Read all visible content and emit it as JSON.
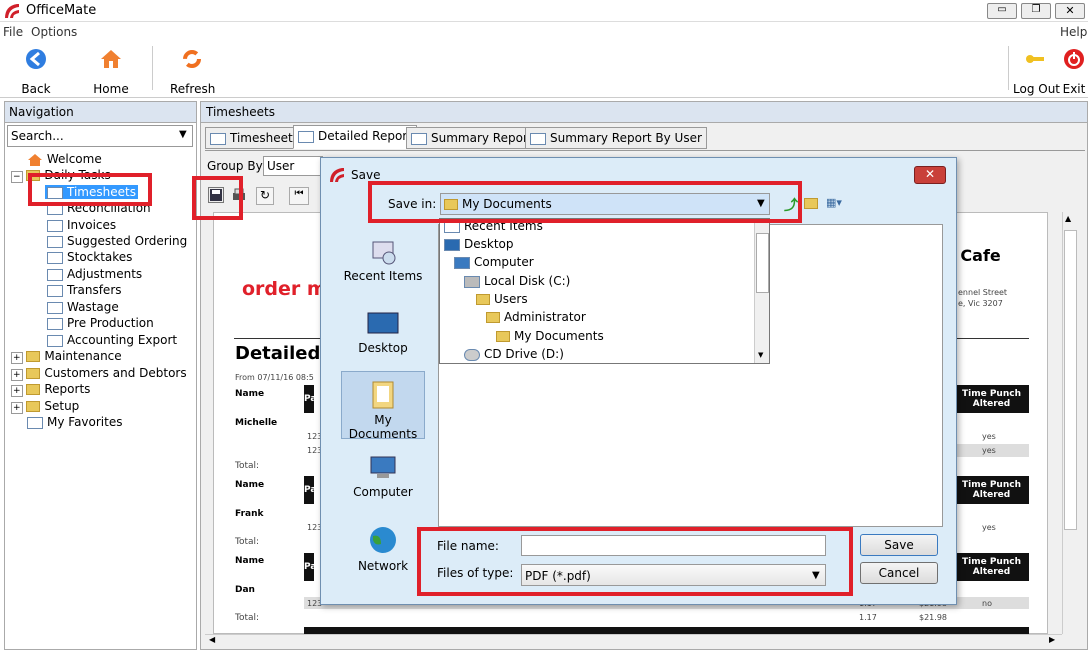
{
  "app": {
    "title": "OfficeMate"
  },
  "menu": {
    "file": "File",
    "options": "Options",
    "help": "Help"
  },
  "toolbar": {
    "back": "Back",
    "home": "Home",
    "refresh": "Refresh",
    "logout": "Log Out",
    "exit": "Exit"
  },
  "navigation": {
    "header": "Navigation",
    "search_value": "Search...",
    "items": {
      "welcome": "Welcome",
      "daily_tasks": "Daily Tasks",
      "timesheets": "Timesheets",
      "reconciliation": "Reconciliation",
      "invoices": "Invoices",
      "suggested_ordering": "Suggested Ordering",
      "stocktakes": "Stocktakes",
      "adjustments": "Adjustments",
      "transfers": "Transfers",
      "wastage": "Wastage",
      "pre_production": "Pre Production",
      "accounting_export": "Accounting Export",
      "maintenance": "Maintenance",
      "customers": "Customers and Debtors",
      "reports": "Reports",
      "setup": "Setup",
      "favorites": "My Favorites"
    }
  },
  "main": {
    "header": "Timesheets",
    "tabs": [
      "Timesheet",
      "Detailed Report",
      "Summary Report",
      "Summary Report By User"
    ],
    "group_by_label": "Group By:",
    "group_by_value": "User"
  },
  "report": {
    "logo": "order m",
    "title": "Detailed",
    "from": "From 07/11/16 08:5",
    "cafe": "e Cafe",
    "addr1": "ennel Street",
    "addr2": "e, Vic 3207",
    "name_label": "Name",
    "total_label": "Total:",
    "col_pa": "Pa",
    "time_punch": "Time Punch Altered",
    "names": [
      "Michelle",
      "Frank",
      "Dan"
    ],
    "num": "123",
    "yes": "yes",
    "no": "no",
    "val1": "1.17",
    "val2": "$21.98"
  },
  "dialog": {
    "title": "Save",
    "save_in_label": "Save in:",
    "save_in_value": "My Documents",
    "places": [
      "Recent Items",
      "Desktop",
      "My Documents",
      "Computer",
      "Network"
    ],
    "folders": [
      "Recent Items",
      "Desktop",
      "Computer",
      "Local Disk (C:)",
      "Users",
      "Administrator",
      "My Documents",
      "CD Drive (D:)"
    ],
    "file_name_label": "File name:",
    "file_name_value": "",
    "file_type_label": "Files of type:",
    "file_type_value": "PDF (*.pdf)",
    "save_button": "Save",
    "cancel_button": "Cancel"
  },
  "colors": {
    "highlight": "#e0202a",
    "selected": "#3399ff",
    "panel_header": "#dbe4f0"
  }
}
